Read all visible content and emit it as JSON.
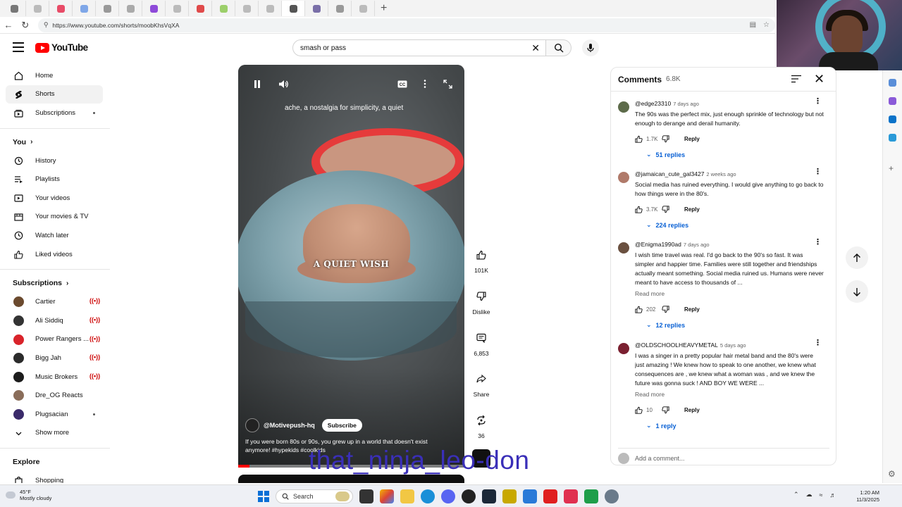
{
  "browser": {
    "url": "https://www.youtube.com/shorts/moobKhsVqXA",
    "tab_count": 16
  },
  "header": {
    "logo_text": "YouTube",
    "search_value": "smash or pass"
  },
  "sidebar": {
    "main": [
      {
        "label": "Home",
        "icon": "home-icon"
      },
      {
        "label": "Shorts",
        "icon": "shorts-icon",
        "active": true
      },
      {
        "label": "Subscriptions",
        "icon": "subscriptions-icon",
        "dot": true
      }
    ],
    "you_heading": "You",
    "you": [
      {
        "label": "History",
        "icon": "history-icon"
      },
      {
        "label": "Playlists",
        "icon": "playlists-icon"
      },
      {
        "label": "Your videos",
        "icon": "your-videos-icon"
      },
      {
        "label": "Your movies & TV",
        "icon": "movies-icon"
      },
      {
        "label": "Watch later",
        "icon": "watch-later-icon"
      },
      {
        "label": "Liked videos",
        "icon": "liked-videos-icon"
      }
    ],
    "subs_heading": "Subscriptions",
    "subs": [
      {
        "label": "Cartier",
        "color": "#6b4a2e",
        "live": true
      },
      {
        "label": "Ali Siddiq",
        "color": "#333333",
        "live": true
      },
      {
        "label": "Power Rangers ...",
        "color": "#d9232a",
        "live": true
      },
      {
        "label": "Bigg Jah",
        "color": "#2b2b2b",
        "live": true
      },
      {
        "label": "Music Brokers",
        "color": "#1c1c1c",
        "live": true
      },
      {
        "label": "Dre_OG Reacts",
        "color": "#8a6d5a",
        "live": false
      },
      {
        "label": "Plugsacian",
        "color": "#3a2a6a",
        "dot": true
      }
    ],
    "show_more": "Show more",
    "explore_heading": "Explore",
    "explore_first": "Shopping"
  },
  "video": {
    "caption_top": "ache, a nostalgia for simplicity, a quiet",
    "caption_center": "A QUIET WISH",
    "channel": "@Motivepush-hq",
    "subscribe": "Subscribe",
    "description": "If you were born 80s or 90s, you grew up in a world that doesn't exist anymore! #hypekids #coolkids",
    "progress": 0.05
  },
  "actions": {
    "likes": "101K",
    "dislike": "Dislike",
    "comments": "6,853",
    "share": "Share",
    "remix": "36"
  },
  "watermark": "that_ninja_leo-don",
  "comments_panel": {
    "title": "Comments",
    "count": "6.8K",
    "reply_label": "Reply",
    "read_more": "Read more",
    "add_placeholder": "Add a comment...",
    "items": [
      {
        "author": "@edge23310",
        "time": "7 days ago",
        "text": "The 90s was the perfect mix, just enough sprinkle of technology but not enough to derange and derail humanity.",
        "likes": "1.7K",
        "replies": "51 replies",
        "avatar_color": "#5d6b4a"
      },
      {
        "author": "@jamaican_cute_gal3427",
        "time": "2 weeks ago",
        "text": "Social media has ruined everything. I would give anything to go back to how things were in the 80's.",
        "likes": "3.7K",
        "replies": "224 replies",
        "avatar_color": "#b07a6a"
      },
      {
        "author": "@Enigma1990ad",
        "time": "7 days ago",
        "text": "I wish time travel was real. I'd go back to the 90's so fast. It was simpler and happier time. Families were still together and friendships actually meant something. Social media ruined us. Humans were never meant to have access to thousands of ...",
        "likes": "202",
        "replies": "12 replies",
        "avatar_color": "#6a5040"
      },
      {
        "author": "@OLDSCHOOLHEAVYMETAL",
        "time": "5 days ago",
        "text": "I was a singer in a pretty popular hair metal band and the 80's were just amazing ! We knew how to speak to one another, we knew what consequences are , we knew what a woman was , and we knew the future was gonna suck ! AND BOY WE WERE ...",
        "likes": "10",
        "replies": "1 reply",
        "avatar_color": "#7a2030"
      }
    ]
  },
  "taskbar": {
    "weather_temp": "45°F",
    "weather_desc": "Mostly cloudy",
    "search": "Search",
    "time": "1:20 AM",
    "date": "11/3/2025"
  }
}
